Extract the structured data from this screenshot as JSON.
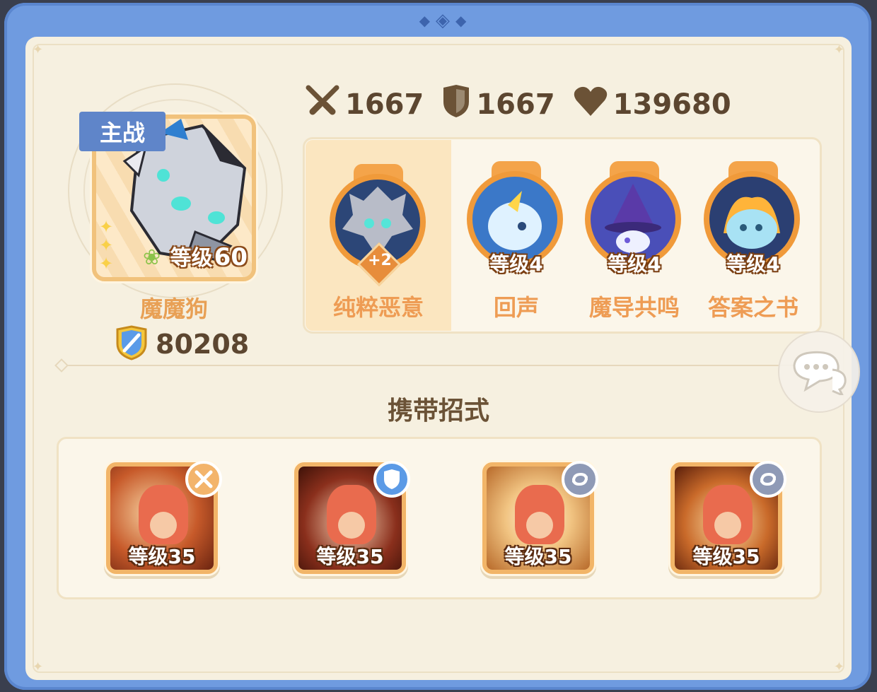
{
  "hero": {
    "tag": "主战",
    "level_label": "等级",
    "level": "60",
    "name": "魔魔狗",
    "power": "80208"
  },
  "stats": {
    "attack": "1667",
    "defense": "1667",
    "hp": "139680"
  },
  "skills": [
    {
      "name": "纯粹恶意",
      "badge": "+2",
      "selected": true
    },
    {
      "name": "回声",
      "level": "等级4"
    },
    {
      "name": "魔导共鸣",
      "level": "等级4"
    },
    {
      "name": "答案之书",
      "level": "等级4"
    }
  ],
  "section_title": "携带招式",
  "moves": [
    {
      "level": "等级35",
      "badge_icon": "sword-cross-icon",
      "badge_color": "#f3b46b"
    },
    {
      "level": "等级35",
      "badge_icon": "shield-icon",
      "badge_color": "#5b9ae6"
    },
    {
      "level": "等级35",
      "badge_icon": "swirl-icon",
      "badge_color": "#8f9ab6"
    },
    {
      "level": "等级35",
      "badge_icon": "swirl-icon",
      "badge_color": "#8f9ab6"
    }
  ],
  "colors": {
    "frame": "#6f9be0",
    "panel": "#f6f0e0",
    "accent": "#f09a3a",
    "tag": "#5f85c9"
  }
}
